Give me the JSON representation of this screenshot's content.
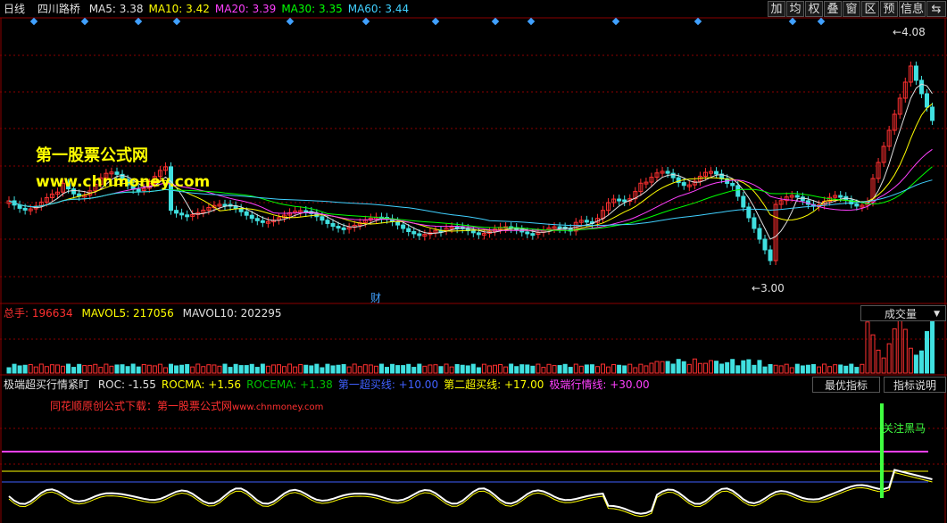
{
  "header": {
    "period": "日线",
    "stock_name": "四川路桥",
    "ma_items": [
      {
        "label": "MA5:",
        "value": "3.38",
        "color": "#e0e0e0"
      },
      {
        "label": "MA10:",
        "value": "3.42",
        "color": "#ffff00"
      },
      {
        "label": "MA20:",
        "value": "3.39",
        "color": "#ff40ff"
      },
      {
        "label": "MA30:",
        "value": "3.35",
        "color": "#00ff00"
      },
      {
        "label": "MA60:",
        "value": "3.44",
        "color": "#40d0ff"
      }
    ],
    "toolbar": [
      "加",
      "均",
      "权",
      "叠",
      "窗",
      "区",
      "预",
      "信息"
    ],
    "toolbar_arrow": "⇆"
  },
  "main_chart": {
    "watermark_title": "第一股票公式网",
    "watermark_url": "www.chnmoney.com",
    "high_label": "4.08",
    "low_label": "3.00",
    "cai_marker": "财"
  },
  "volume_panel": {
    "total_label": "总手:",
    "total_value": "196634",
    "mavol5_label": "MAVOL5:",
    "mavol5_value": "217056",
    "mavol10_label": "MAVOL10:",
    "mavol10_value": "202295",
    "dropdown": "成交量"
  },
  "indicator_panel": {
    "name": "极端超买行情紧盯",
    "items": [
      {
        "label": "ROC:",
        "value": "-1.55",
        "color": "#e0e0e0"
      },
      {
        "label": "ROCMA:",
        "value": "+1.56",
        "color": "#ffff00"
      },
      {
        "label": "ROCEMA:",
        "value": "+1.38",
        "color": "#00c000"
      },
      {
        "label": "第一超买线:",
        "value": "+10.00",
        "color": "#4060ff"
      },
      {
        "label": "第二超买线:",
        "value": "+17.00",
        "color": "#ffff00"
      },
      {
        "label": "极端行情线:",
        "value": "+30.00",
        "color": "#ff40ff"
      }
    ],
    "best_button": "最优指标",
    "explain_button": "指标说明",
    "download_note": "同花顺原创公式下载：第一股票公式网",
    "download_url": "www.chnmoney.com",
    "alert_label": "关注黑马"
  },
  "colors": {
    "up": "#ff3030",
    "down": "#40e0e0",
    "grid": "#8b0000",
    "diamond": "#40a0ff"
  }
}
